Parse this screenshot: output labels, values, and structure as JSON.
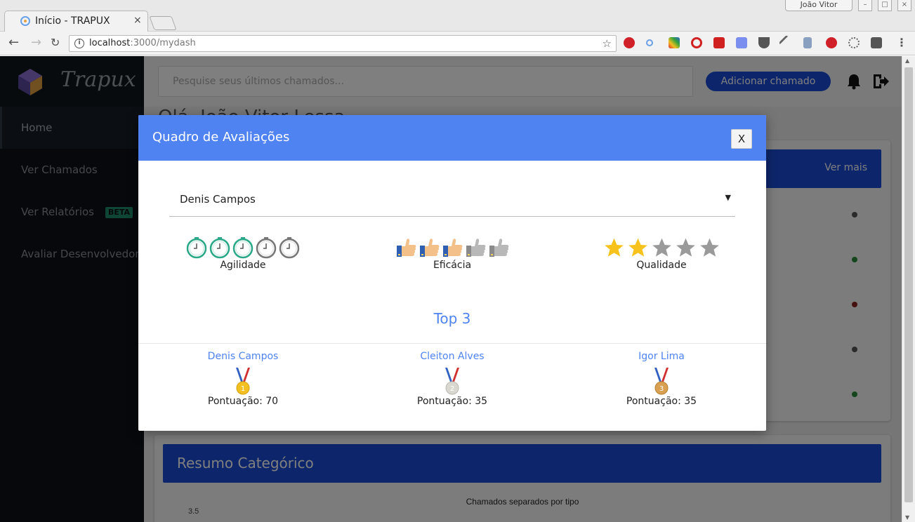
{
  "browser": {
    "tab_title": "Início - TRAPUX",
    "tab_close": "×",
    "url_host": "localhost",
    "url_rest": ":3000/mydash",
    "profile_name": "João Vitor"
  },
  "app": {
    "logo_text": "Trapux",
    "sidebar": {
      "items": [
        {
          "label": "Home"
        },
        {
          "label": "Ver Chamados"
        },
        {
          "label": "Ver Relatórios",
          "badge": "BETA"
        },
        {
          "label": "Avaliar Desenvolvedor"
        }
      ]
    },
    "search": {
      "placeholder": "Pesquise seus últimos chamados..."
    },
    "add_button": "Adicionar chamado",
    "greeting": "Olá, João Vitor Lessa",
    "card": {
      "more_link": "Ver mais",
      "status_colors": [
        "#555555",
        "#2a8a3a",
        "#8a2020",
        "#555555",
        "#2a8a3a"
      ]
    },
    "summary": {
      "title": "Resumo Categórico",
      "chart_title": "Chamados separados por tipo",
      "first_tick": "3.5"
    },
    "colors": {
      "primary": "#1a4dd6",
      "modal_header": "#4f83f2",
      "sidebar": "#0d1117"
    }
  },
  "modal": {
    "title": "Quadro de Avaliações",
    "close_label": "X",
    "selected_developer": "Denis Campos",
    "ratings": [
      {
        "label": "Agilidade",
        "icon": "clock-icon",
        "filled": 3,
        "total": 5
      },
      {
        "label": "Eficácia",
        "icon": "thumbs-up-icon",
        "filled": 3,
        "total": 5
      },
      {
        "label": "Qualidade",
        "icon": "star-icon",
        "filled": 2,
        "total": 5
      }
    ],
    "top3_title": "Top 3",
    "top3": [
      {
        "name": "Denis Campos",
        "place": "1",
        "medal": "gold-medal-icon",
        "score": "Pontuação: 70"
      },
      {
        "name": "Cleiton Alves",
        "place": "2",
        "medal": "silver-medal-icon",
        "score": "Pontuação: 35"
      },
      {
        "name": "Igor Lima",
        "place": "3",
        "medal": "bronze-medal-icon",
        "score": "Pontuação: 35"
      }
    ]
  }
}
